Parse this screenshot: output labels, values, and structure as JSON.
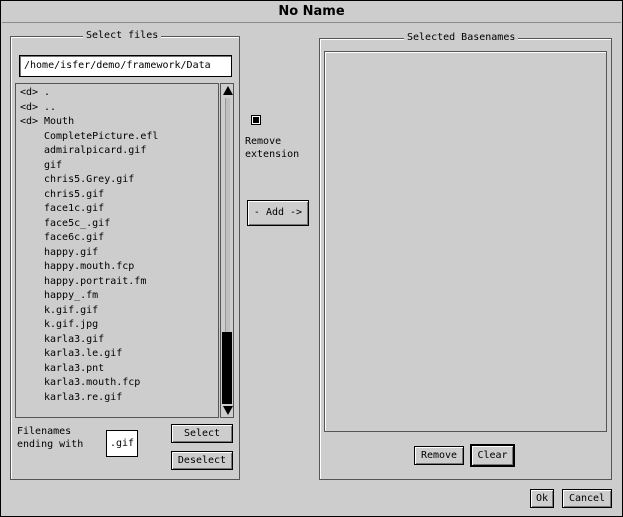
{
  "window": {
    "title": "No Name"
  },
  "select_files": {
    "title": "Select files",
    "path": "/home/isfer/demo/framework/Data",
    "entries": [
      {
        "tag": "<d>",
        "name": "."
      },
      {
        "tag": "<d>",
        "name": ".."
      },
      {
        "tag": "<d>",
        "name": "Mouth"
      },
      {
        "tag": "",
        "name": "CompletePicture.efl"
      },
      {
        "tag": "",
        "name": "admiralpicard.gif"
      },
      {
        "tag": "",
        "name": "gif"
      },
      {
        "tag": "",
        "name": "chris5.Grey.gif"
      },
      {
        "tag": "",
        "name": "chris5.gif"
      },
      {
        "tag": "",
        "name": "face1c.gif"
      },
      {
        "tag": "",
        "name": "face5c_.gif"
      },
      {
        "tag": "",
        "name": "face6c.gif"
      },
      {
        "tag": "",
        "name": "happy.gif"
      },
      {
        "tag": "",
        "name": "happy.mouth.fcp"
      },
      {
        "tag": "",
        "name": "happy.portrait.fm"
      },
      {
        "tag": "",
        "name": "happy_.fm"
      },
      {
        "tag": "",
        "name": "k.gif.gif"
      },
      {
        "tag": "",
        "name": "k.gif.jpg"
      },
      {
        "tag": "",
        "name": "karla3.gif"
      },
      {
        "tag": "",
        "name": "karla3.le.gif"
      },
      {
        "tag": "",
        "name": "karla3.pnt"
      },
      {
        "tag": "",
        "name": "karla3.mouth.fcp"
      },
      {
        "tag": "",
        "name": "karla3.re.gif"
      }
    ],
    "filter_label": "Filenames\nending with",
    "filter_value": ".gif",
    "select_label": "Select",
    "deselect_label": "Deselect"
  },
  "middle": {
    "remove_extension_label": "Remove\nextension",
    "remove_extension_checked": true,
    "add_label": "- Add ->"
  },
  "selected_basenames": {
    "title": "Selected Basenames",
    "items": [],
    "remove_label": "Remove",
    "clear_label": "Clear"
  },
  "footer": {
    "ok_label": "Ok",
    "cancel_label": "Cancel"
  },
  "scroll": {
    "thumb_start_fraction": 0.74,
    "thumb_end_fraction": 0.955
  }
}
